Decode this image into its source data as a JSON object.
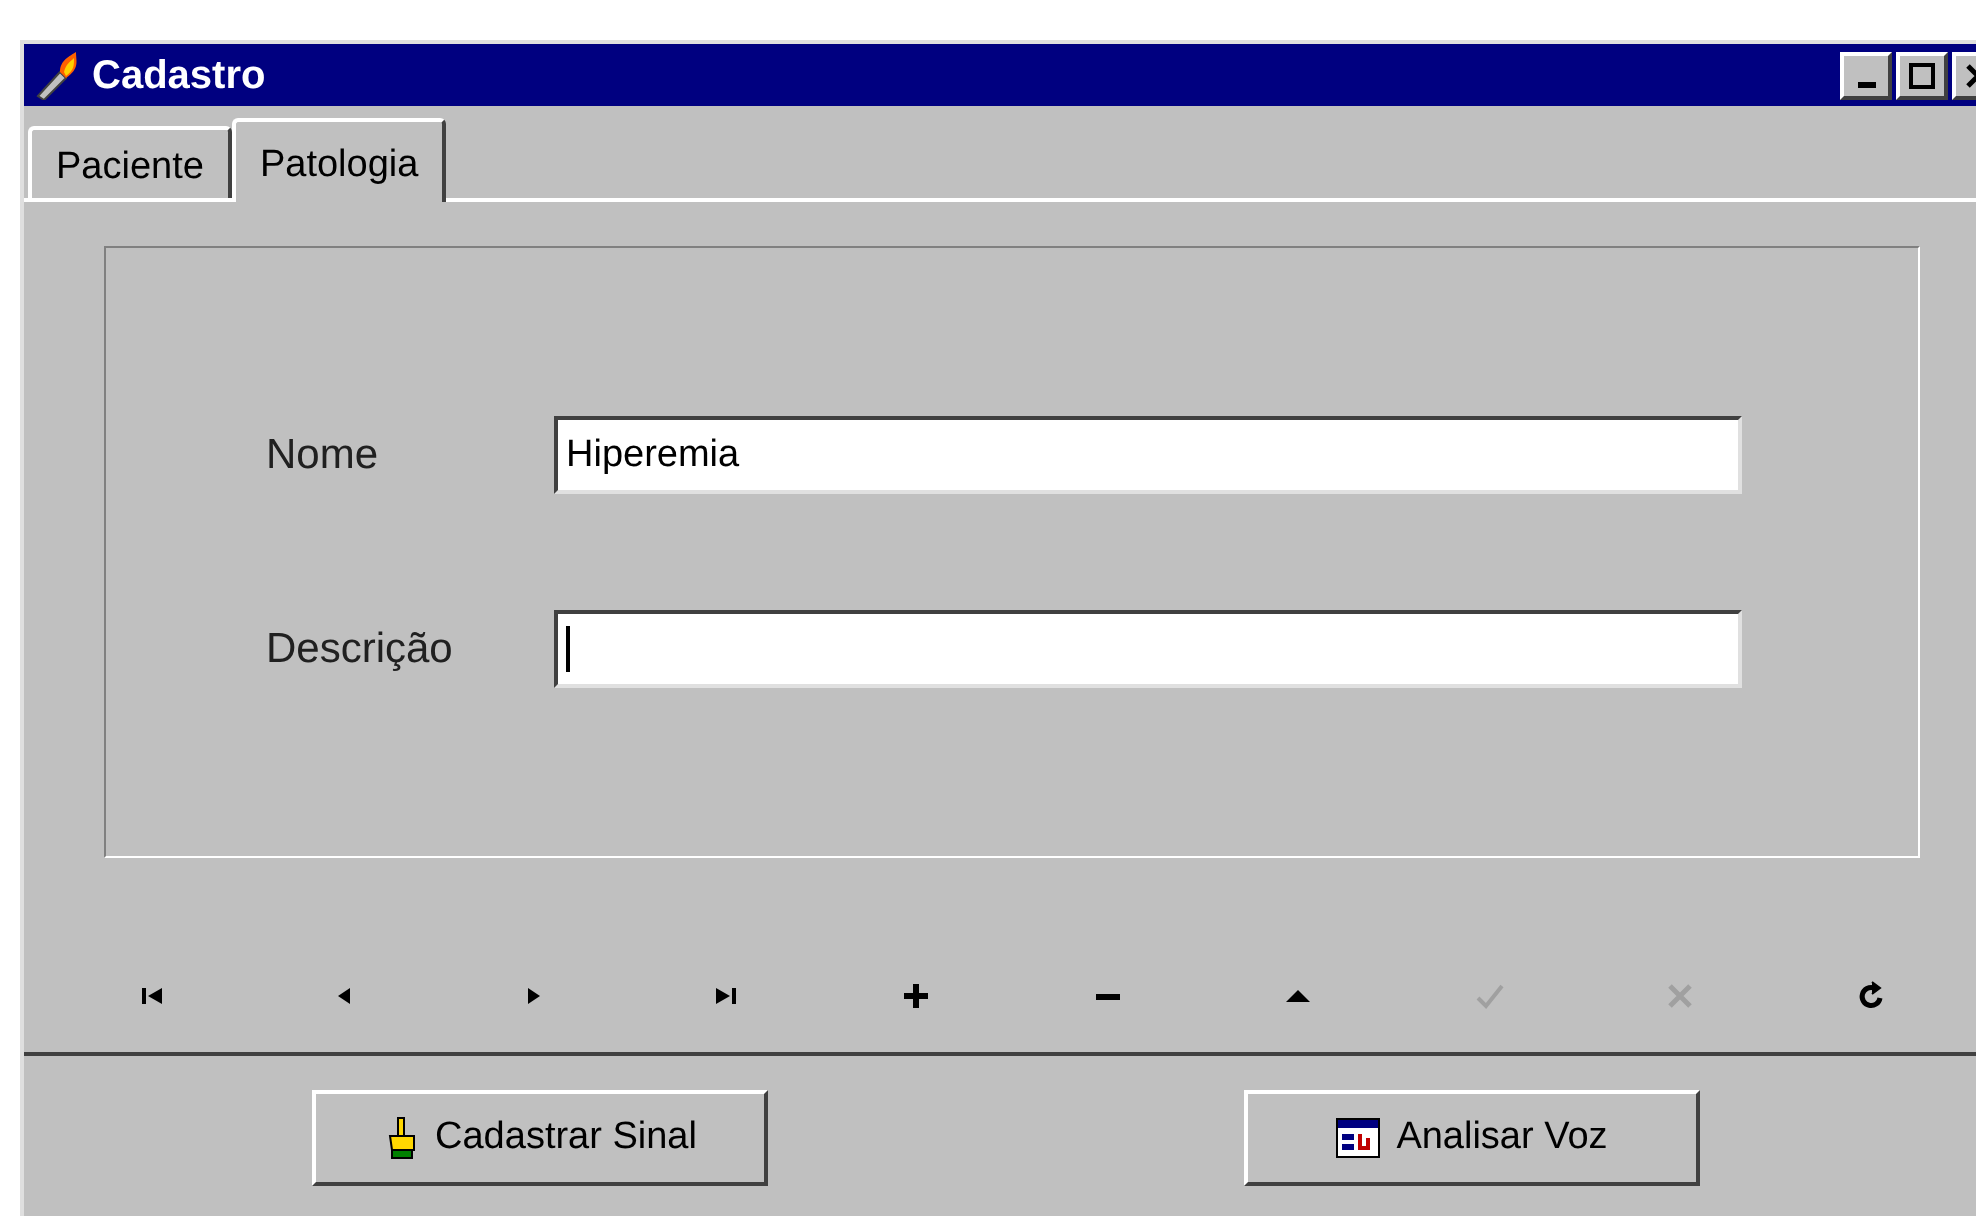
{
  "window": {
    "title": "Cadastro"
  },
  "tabs": [
    {
      "label": "Paciente",
      "selected": false
    },
    {
      "label": "Patologia",
      "selected": true
    }
  ],
  "form": {
    "fields": [
      {
        "label": "Nome",
        "value": "Hiperemia",
        "focused": false
      },
      {
        "label": "Descrição",
        "focused": true
      }
    ]
  },
  "navigator": [
    {
      "kind": "first",
      "disabled": false
    },
    {
      "kind": "prior",
      "disabled": false
    },
    {
      "kind": "next",
      "disabled": false
    },
    {
      "kind": "last",
      "disabled": false
    },
    {
      "kind": "insert",
      "disabled": false
    },
    {
      "kind": "delete",
      "disabled": false
    },
    {
      "kind": "edit",
      "disabled": false
    },
    {
      "kind": "post",
      "disabled": true
    },
    {
      "kind": "cancel",
      "disabled": true
    },
    {
      "kind": "refresh",
      "disabled": false
    }
  ],
  "buttons": [
    {
      "kind": "hand",
      "label": "Cadastrar Sinal"
    },
    {
      "kind": "chart",
      "label": "Analisar Voz"
    }
  ]
}
